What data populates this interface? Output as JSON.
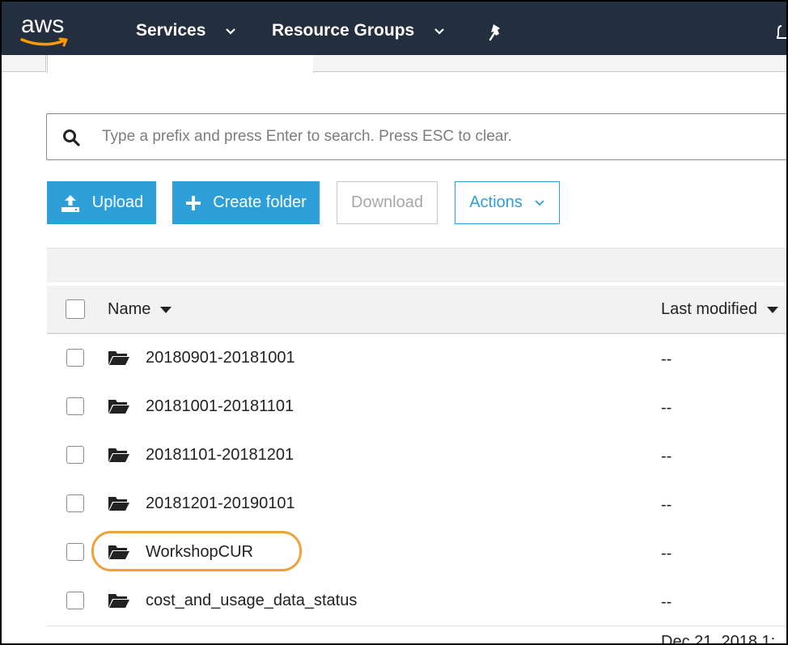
{
  "nav": {
    "logo_text": "aws",
    "services_label": "Services",
    "resource_groups_label": "Resource Groups",
    "brand_color": "#232f3e",
    "accent_color": "#ff9900"
  },
  "search": {
    "placeholder": "Type a prefix and press Enter to search. Press ESC to clear."
  },
  "toolbar": {
    "upload_label": "Upload",
    "create_folder_label": "Create folder",
    "download_label": "Download",
    "actions_label": "Actions",
    "button_color": "#2e9fd9"
  },
  "table": {
    "headers": {
      "name": "Name",
      "last_modified": "Last modified"
    },
    "rows": [
      {
        "name": "20180901-20181001",
        "last_modified": "--"
      },
      {
        "name": "20181001-20181101",
        "last_modified": "--"
      },
      {
        "name": "20181101-20181201",
        "last_modified": "--"
      },
      {
        "name": "20181201-20190101",
        "last_modified": "--"
      },
      {
        "name": "WorkshopCUR",
        "last_modified": "--",
        "highlighted": true
      },
      {
        "name": "cost_and_usage_data_status",
        "last_modified": "--"
      }
    ],
    "next_row_last_modified_partial": "Dec 21, 2018 1:",
    "highlight_color": "#f0a23a"
  }
}
